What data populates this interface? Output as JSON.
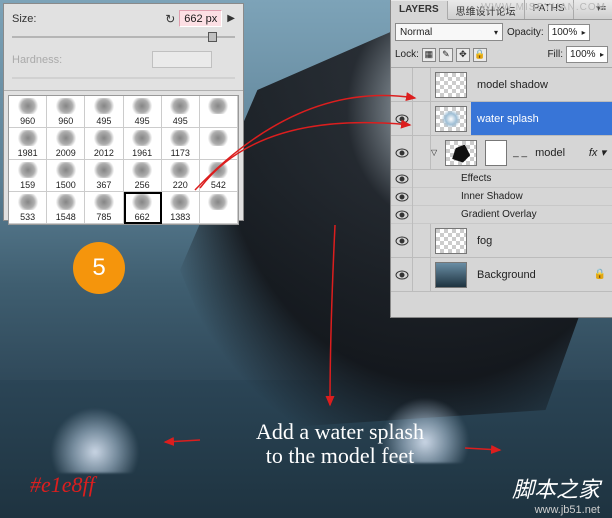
{
  "brush_panel": {
    "size_label": "Size:",
    "size_value": "662 px",
    "hardness_label": "Hardness:",
    "brushes": [
      {
        "n": "960"
      },
      {
        "n": "960"
      },
      {
        "n": "495"
      },
      {
        "n": "495"
      },
      {
        "n": "495"
      },
      {
        "n": ""
      },
      {
        "n": "1981"
      },
      {
        "n": "2009"
      },
      {
        "n": "2012"
      },
      {
        "n": "1961"
      },
      {
        "n": "1173"
      },
      {
        "n": ""
      },
      {
        "n": "159"
      },
      {
        "n": "1500"
      },
      {
        "n": "367"
      },
      {
        "n": "256"
      },
      {
        "n": "220"
      },
      {
        "n": "542"
      },
      {
        "n": "533"
      },
      {
        "n": "1548"
      },
      {
        "n": "785"
      },
      {
        "n": "662",
        "sel": true
      },
      {
        "n": "1383"
      },
      {
        "n": ""
      }
    ]
  },
  "layers_panel": {
    "tabs": {
      "layers": "LAYERS",
      "channels": "思维设计论坛",
      "paths": "PATHS"
    },
    "blend_mode": "Normal",
    "opacity_label": "Opacity:",
    "opacity_value": "100%",
    "lock_label": "Lock:",
    "fill_label": "Fill:",
    "fill_value": "100%",
    "layers": [
      {
        "name": "model shadow",
        "vis": false
      },
      {
        "name": "water splash",
        "vis": true,
        "selected": true
      },
      {
        "name": "model",
        "vis": true,
        "fx": true,
        "fx_label": "fx"
      },
      {
        "name": "fog",
        "vis": true
      },
      {
        "name": "Background",
        "vis": true,
        "locked": true,
        "bg": true
      }
    ],
    "effects_label": "Effects",
    "effects": [
      "Inner Shadow",
      "Gradient Overlay"
    ]
  },
  "overlay": {
    "step": "5",
    "annotation": "Add a water splash\nto the model feet",
    "color_code": "#e1e8ff",
    "watermark_cn": "脚本之家",
    "watermark_url": "www.jb51.net",
    "top_wm": "WWW.MISSYUAN.COM"
  }
}
